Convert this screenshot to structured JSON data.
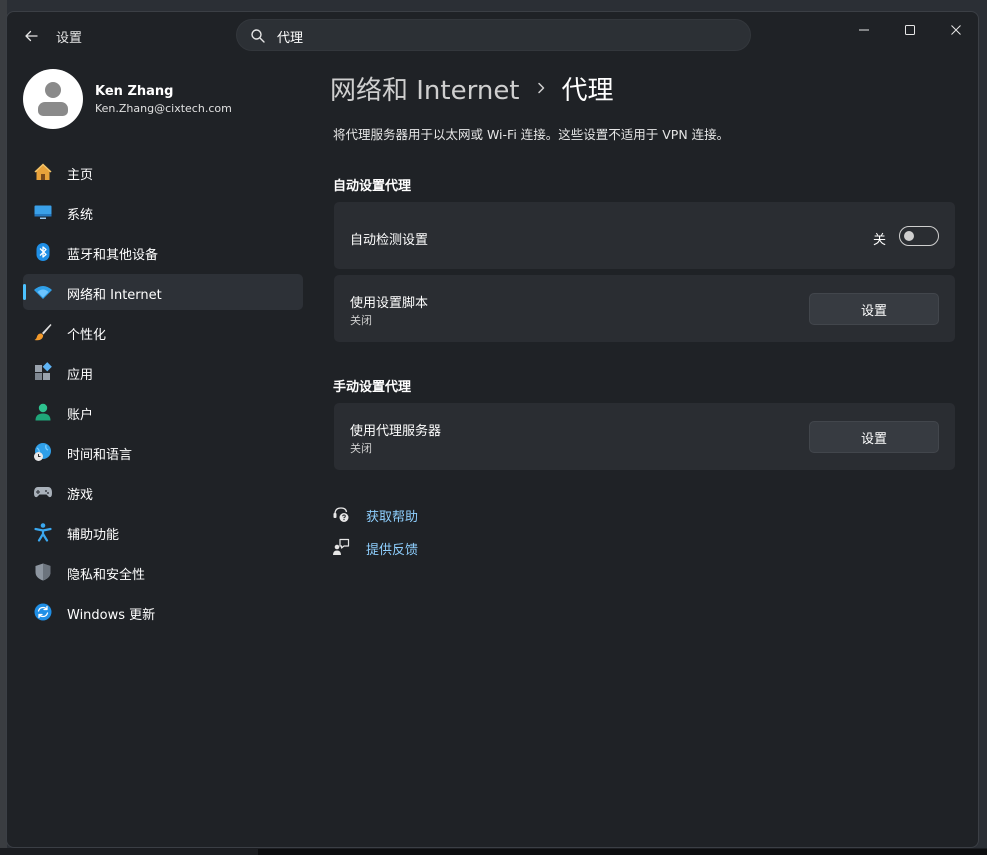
{
  "window": {
    "title": "设置",
    "search_value": "代理"
  },
  "profile": {
    "name": "Ken  Zhang",
    "email": "Ken.Zhang@cixtech.com"
  },
  "sidebar": {
    "items": [
      {
        "label": "主页",
        "icon": "home-icon"
      },
      {
        "label": "系统",
        "icon": "monitor-icon"
      },
      {
        "label": "蓝牙和其他设备",
        "icon": "bluetooth-icon"
      },
      {
        "label": "网络和 Internet",
        "icon": "wifi-icon",
        "active": true
      },
      {
        "label": "个性化",
        "icon": "brush-icon"
      },
      {
        "label": "应用",
        "icon": "apps-icon"
      },
      {
        "label": "账户",
        "icon": "account-icon"
      },
      {
        "label": "时间和语言",
        "icon": "globe-clock-icon"
      },
      {
        "label": "游戏",
        "icon": "gamepad-icon"
      },
      {
        "label": "辅助功能",
        "icon": "accessibility-icon"
      },
      {
        "label": "隐私和安全性",
        "icon": "shield-icon"
      },
      {
        "label": "Windows 更新",
        "icon": "update-icon"
      }
    ]
  },
  "main": {
    "breadcrumb_parent": "网络和 Internet",
    "breadcrumb_current": "代理",
    "description": "将代理服务器用于以太网或 Wi-Fi 连接。这些设置不适用于 VPN 连接。",
    "auto_section": {
      "title": "自动设置代理",
      "detect": {
        "label": "自动检测设置",
        "toggle_state": "关"
      },
      "script": {
        "label": "使用设置脚本",
        "status": "关闭",
        "button": "设置"
      }
    },
    "manual_section": {
      "title": "手动设置代理",
      "proxy": {
        "label": "使用代理服务器",
        "status": "关闭",
        "button": "设置"
      }
    },
    "links": {
      "help": "获取帮助",
      "feedback": "提供反馈"
    }
  },
  "colors": {
    "accent": "#4cc2ff",
    "link": "#8fd0ff",
    "window_bg": "#1f2226",
    "card_bg": "#2a2d32"
  }
}
